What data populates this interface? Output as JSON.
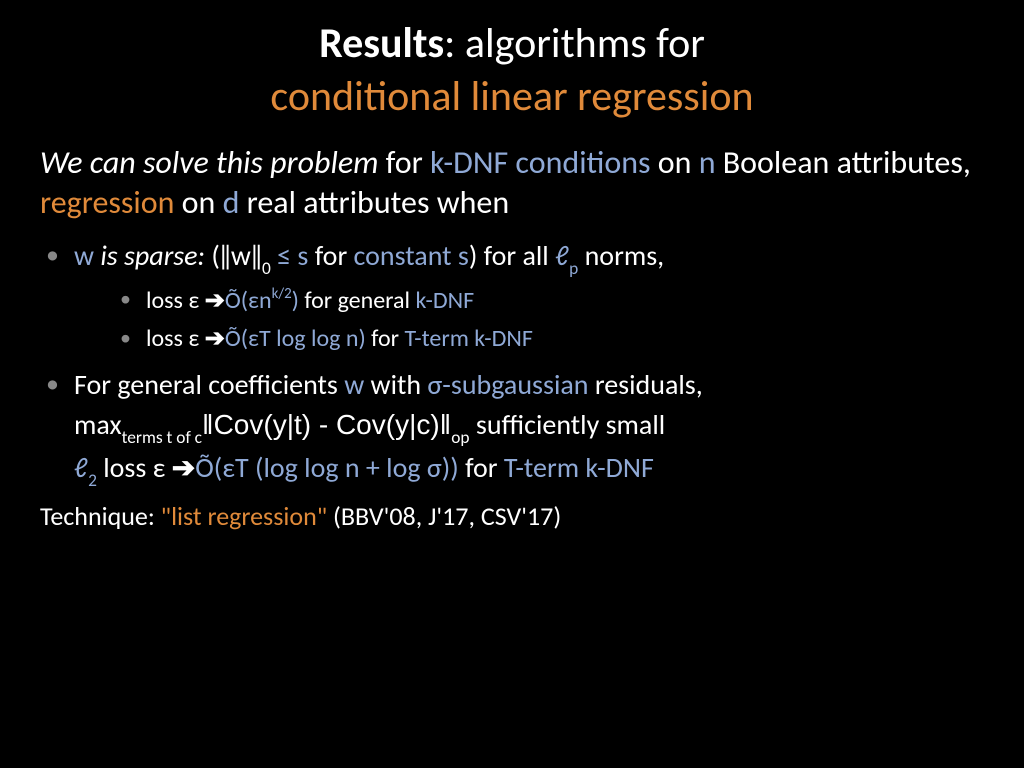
{
  "title": {
    "results_bold": "Results",
    "rest_line1": ": algorithms for",
    "line2": "conditional linear regression"
  },
  "intro": {
    "we_can": "We can solve this problem",
    "for": " for ",
    "kdnf_cond": "k-DNF conditions",
    "on": " on ",
    "n": "n",
    "bool_attr": " Boolean attributes, ",
    "regression": "regression",
    "on2": " on ",
    "d": "d",
    "real_attr": " real attributes when"
  },
  "b1": {
    "w": "w",
    "is_sparse": " is sparse:",
    "open": " (‖w‖",
    "zero_sub": "0",
    "le_s": " ≤ s",
    "for": " for ",
    "constant_s": "constant s",
    "for_all": ") for all ",
    "lp": "ℓ",
    "p_sub": "p",
    "norms": " norms,"
  },
  "b1a": {
    "loss_pre": "loss ε ",
    "arrow": "➔",
    "otilde": "Õ(",
    "eps_n": "εn",
    "k2": "k/2",
    "close": ")",
    "for": " for general ",
    "kdnf": "k-DNF"
  },
  "b1b": {
    "loss_pre": "loss ε ",
    "arrow": "➔",
    "otilde": "Õ(",
    "content": "εT log log n)",
    "for": " for ",
    "tterm": "T-term k-DNF"
  },
  "b2": {
    "prefix": "For general coefficients ",
    "w": "w",
    "with": " with ",
    "sigma_sg": "σ-subgaussian",
    "resid": " residuals,",
    "max": "max",
    "max_sub": "terms t of c",
    "cov": "‖Cov(y|t) - Cov(y|c)‖",
    "op_sub": "op",
    "suff": "  sufficiently small",
    "l2": "ℓ",
    "two_sub": "2",
    "loss": " loss ε ",
    "arrow": "➔",
    "otilde": "Õ(",
    "content": "εT (log log n + log σ))",
    "for": " for ",
    "tterm": "T-term k-DNF"
  },
  "tech": {
    "label": "Technique: ",
    "listreg": "\"list regression\"",
    "refs": " (BBV'08, J'17, CSV'17)"
  }
}
